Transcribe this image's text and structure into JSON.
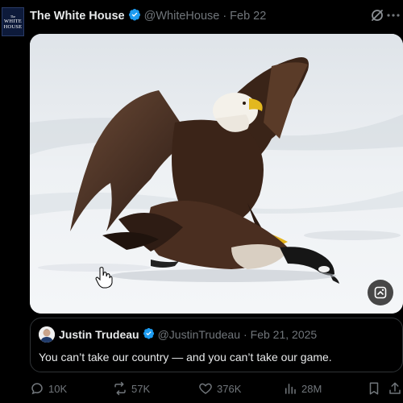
{
  "post": {
    "avatar_small": "The",
    "avatar_big": "WHITE HOUSE",
    "author_name": "The White House",
    "handle": "@WhiteHouse",
    "separator": "·",
    "date": "Feb 22"
  },
  "media": {
    "alt_icon": "media-options-icon"
  },
  "quoted": {
    "author_name": "Justin Trudeau",
    "handle": "@JustinTrudeau",
    "separator": "·",
    "date": "Feb 21, 2025",
    "text": "You can’t take our country — and you can’t take our game."
  },
  "actions": {
    "replies": "10K",
    "reposts": "57K",
    "likes": "376K",
    "views": "28M"
  },
  "colors": {
    "verified_badge": "#1d9bf0",
    "muted_text": "#71767b",
    "border": "#2f3336"
  }
}
